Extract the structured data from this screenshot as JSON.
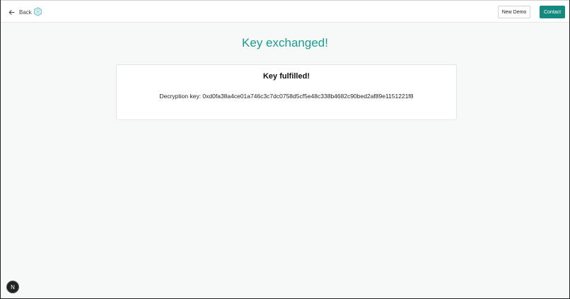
{
  "header": {
    "back_label": "Back",
    "new_demo_label": "New Demo",
    "contact_label": "Contact"
  },
  "main": {
    "heading": "Key exchanged!",
    "card": {
      "title": "Key fulfilled!",
      "key_text": "Decryption key: 0xd0fa38a4ce01a746c3c7dc0758d5cf5e48c338b4682c90bed2af89e1151221f8"
    }
  },
  "dev_badge": {
    "label": "N"
  },
  "colors": {
    "accent": "#1a9c90",
    "button": "#14897f"
  }
}
